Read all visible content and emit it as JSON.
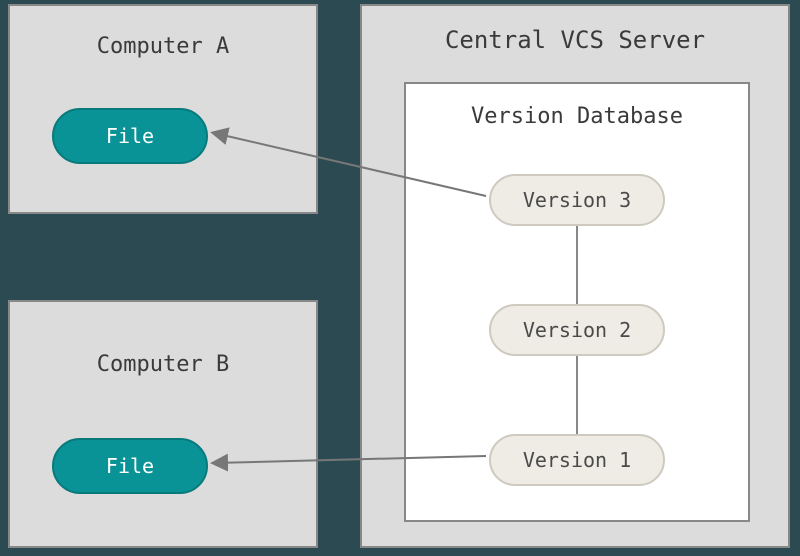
{
  "diagram": {
    "computerA": {
      "title": "Computer A",
      "file_label": "File"
    },
    "computerB": {
      "title": "Computer B",
      "file_label": "File"
    },
    "server": {
      "title": "Central VCS Server",
      "database": {
        "title": "Version Database",
        "versions": {
          "v3": "Version 3",
          "v2": "Version 2",
          "v1": "Version 1"
        }
      }
    }
  },
  "colors": {
    "accent": "#0a9396",
    "box_bg": "#dcdcdc",
    "page_bg": "#2c4a52"
  }
}
